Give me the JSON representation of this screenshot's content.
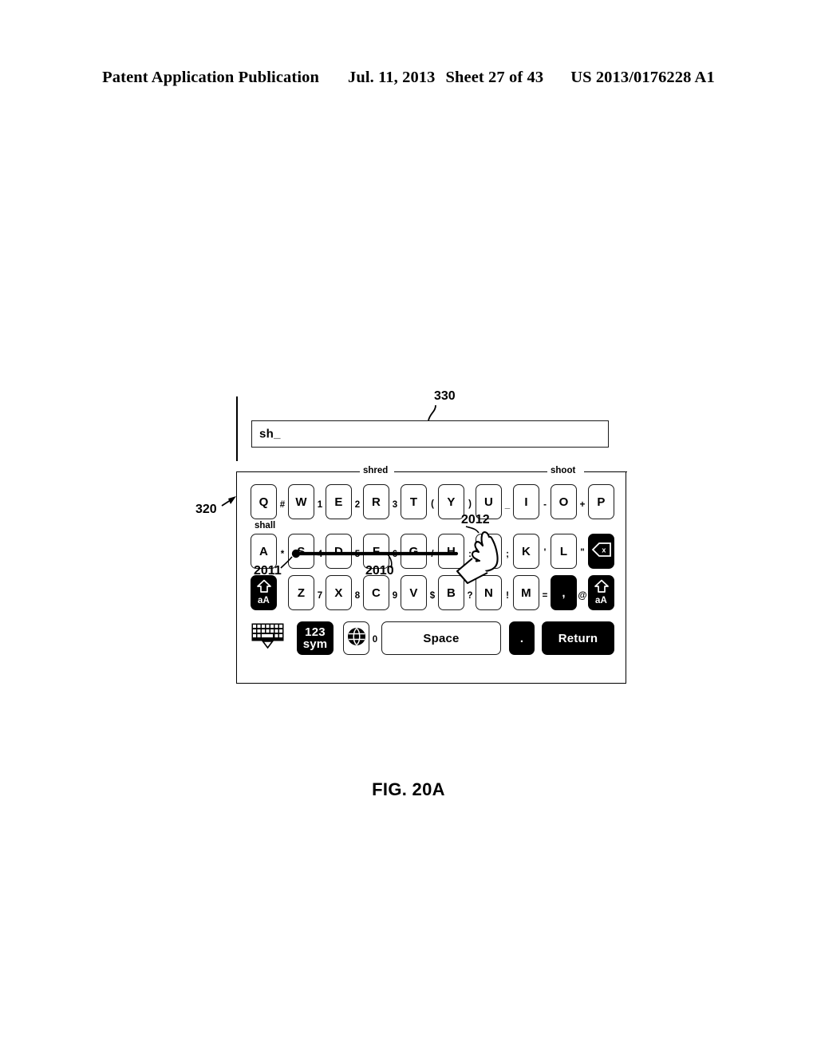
{
  "header": {
    "title": "Patent Application Publication",
    "date": "Jul. 11, 2013",
    "sheet": "Sheet 27 of 43",
    "number": "US 2013/0176228 A1"
  },
  "figure": {
    "caption": "FIG. 20A",
    "reference_numerals": [
      {
        "id": "320",
        "label": "320",
        "target": "keyboard-panel"
      },
      {
        "id": "330",
        "label": "330",
        "target": "text-input-field"
      },
      {
        "id": "2010",
        "label": "2010",
        "target": "swipe-trace"
      },
      {
        "id": "2011",
        "label": "2011",
        "target": "trace-start-point"
      },
      {
        "id": "2012",
        "label": "2012",
        "target": "hand-cursor"
      }
    ]
  },
  "text_field": {
    "value": "sh_"
  },
  "word_hints": {
    "top_left": "shred",
    "top_right": "shoot",
    "inline_left": "shall"
  },
  "keyboard": {
    "row1": {
      "keys": [
        "Q",
        "W",
        "E",
        "R",
        "T",
        "Y",
        "U",
        "I",
        "O",
        "P"
      ],
      "symbols": [
        "#",
        "1",
        "2",
        "3",
        "(",
        ")",
        "_",
        "-",
        "+"
      ]
    },
    "row2": {
      "keys": [
        "A",
        "S",
        "D",
        "F",
        "G",
        "H",
        "J",
        "K",
        "L"
      ],
      "symbols": [
        "*",
        "4",
        "5",
        "6",
        "/",
        ":",
        ";",
        "'",
        "\""
      ],
      "backspace": {
        "name": "backspace-key",
        "glyph": "x"
      }
    },
    "row3": {
      "shift_left": {
        "label": "aA",
        "glyph": "shift-arrow"
      },
      "keys": [
        "Z",
        "X",
        "C",
        "V",
        "B",
        "N",
        "M",
        ","
      ],
      "symbols": [
        "7",
        "8",
        "9",
        "$",
        "?",
        "!",
        "=",
        "@"
      ],
      "shift_right": {
        "label": "aA",
        "glyph": "shift-arrow"
      }
    },
    "row4": {
      "dismiss": "keyboard-dismiss-icon",
      "numsym_line1": "123",
      "numsym_line2": "sym",
      "globe": "globe-icon",
      "zero": "0",
      "space": "Space",
      "period": ".",
      "return": "Return"
    }
  }
}
